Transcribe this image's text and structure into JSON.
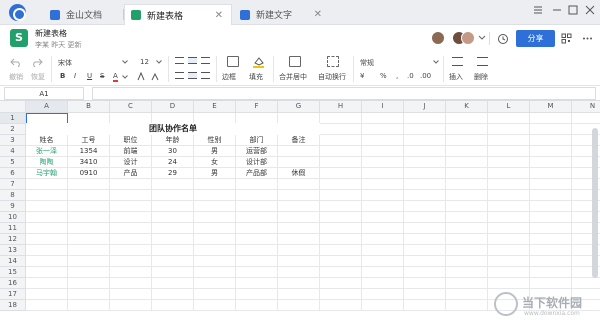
{
  "tabs": [
    {
      "label": "金山文档",
      "active": false,
      "icon": "layers-icon",
      "color": "#2f6fd8"
    },
    {
      "label": "新建表格",
      "active": true,
      "icon": "sheet-icon",
      "color": "#22a06b"
    },
    {
      "label": "新建文字",
      "active": false,
      "icon": "doc-icon",
      "color": "#2f6fd8"
    }
  ],
  "header": {
    "doc_icon_letter": "S",
    "title": "新建表格",
    "meta": "李某 昨天 更新",
    "share_label": "分享"
  },
  "toolbar": {
    "undo": "撤销",
    "redo": "恢复",
    "font": "宋体",
    "size": "12",
    "bold": "B",
    "italic": "I",
    "underline": "U",
    "strike": "S",
    "font_color": "A",
    "border": "边框",
    "fill": "填充",
    "merge": "合并居中",
    "wrap": "自动换行",
    "format": "常规",
    "currency": "¥",
    "percent": "%",
    "insert": "插入",
    "delete": "删除"
  },
  "formula": {
    "cell_ref": "A1",
    "value": ""
  },
  "grid": {
    "columns": [
      "A",
      "B",
      "C",
      "D",
      "E",
      "F",
      "G",
      "H",
      "I",
      "J",
      "K",
      "L",
      "M",
      "N"
    ],
    "rows": [
      "1",
      "2",
      "3",
      "4",
      "5",
      "6",
      "7",
      "8",
      "9",
      "10",
      "11",
      "12",
      "13",
      "14",
      "15",
      "16",
      "17",
      "18"
    ],
    "title": "团队协作名单",
    "headers": [
      "姓名",
      "工号",
      "职位",
      "年龄",
      "性别",
      "部门",
      "备注"
    ],
    "records": [
      [
        "张一泽",
        "1354",
        "前端",
        "30",
        "男",
        "运营部",
        ""
      ],
      [
        "陶陶",
        "3410",
        "设计",
        "24",
        "女",
        "设计部",
        ""
      ],
      [
        "马宇翰",
        "0910",
        "产品",
        "29",
        "男",
        "产品部",
        "休假"
      ]
    ]
  },
  "watermark": {
    "text": "当下软件园",
    "url": "www.downxia.com"
  },
  "colors": {
    "accent": "#2f6fd8",
    "green": "#22a06b"
  }
}
